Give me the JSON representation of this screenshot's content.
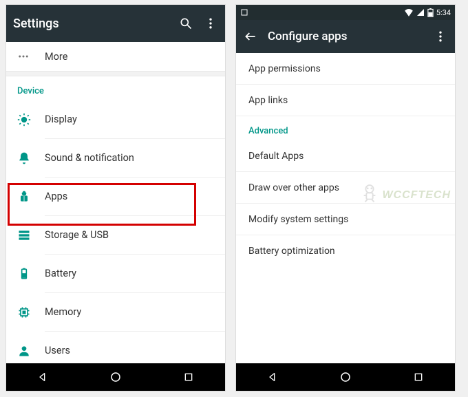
{
  "left": {
    "appbar": {
      "title": "Settings"
    },
    "more": "More",
    "deviceHeader": "Device",
    "items": [
      {
        "label": "Display"
      },
      {
        "label": "Sound & notification"
      },
      {
        "label": "Apps"
      },
      {
        "label": "Storage & USB"
      },
      {
        "label": "Battery"
      },
      {
        "label": "Memory"
      },
      {
        "label": "Users"
      }
    ]
  },
  "right": {
    "status": {
      "time": "5:34"
    },
    "appbar": {
      "title": "Configure apps"
    },
    "items": [
      "App permissions",
      "App links"
    ],
    "advancedHeader": "Advanced",
    "advancedItems": [
      "Default Apps",
      "Draw over other apps",
      "Modify system settings",
      "Battery optimization"
    ]
  },
  "watermark": "WCCFTECH"
}
